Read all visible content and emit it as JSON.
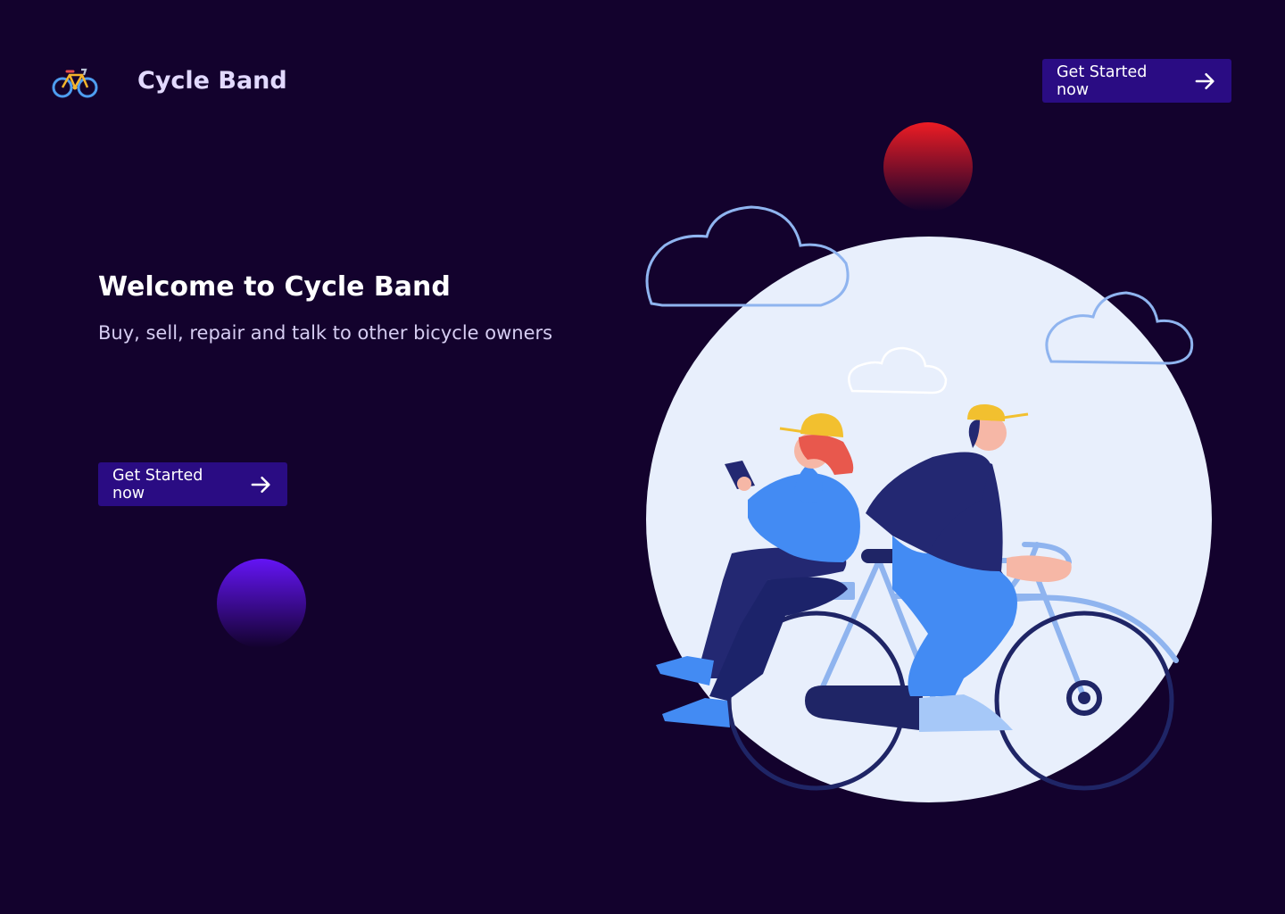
{
  "header": {
    "logo_icon": "bicycle-icon",
    "brand_name": "Cycle Band",
    "cta_label": "Get Started now"
  },
  "hero": {
    "title": "Welcome to Cycle Band",
    "subtitle": "Buy, sell, repair and talk to other bicycle owners",
    "cta_label": "Get Started now",
    "cta_icon": "arrow-right-icon"
  },
  "illustration": {
    "name": "two-riders-on-bicycle-illustration",
    "icons": [
      "cloud-icon",
      "moon-circle",
      "bicycle"
    ]
  },
  "colors": {
    "background": "#13022d",
    "button": "#2a0c83",
    "brand_text": "#e2d9ff",
    "accent_red": "#ec1c24",
    "accent_purple": "#6414f5",
    "circle_bg": "#e8effc",
    "cloud": "#8fb4ef"
  }
}
